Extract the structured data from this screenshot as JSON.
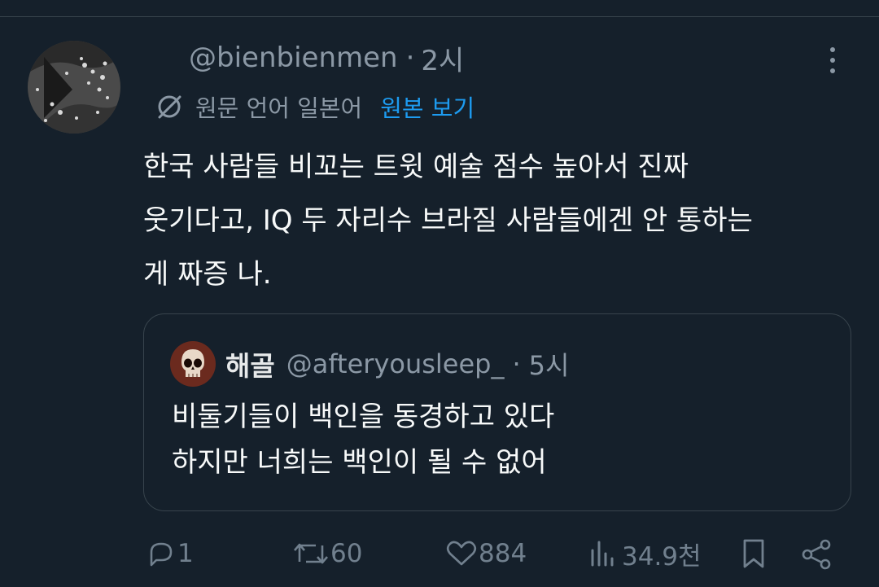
{
  "tweet": {
    "handle": "@bienbienmen",
    "separator": "·",
    "time": "2시",
    "translation": {
      "label": "원문 언어 일본어",
      "show_original": "원본 보기"
    },
    "lines": [
      "한국 사람들 비꼬는 트윗 예술 점수 높아서 진짜",
      "웃기다고, IQ 두 자리수 브라질 사람들에겐 안 통하는",
      "게 짜증 나."
    ]
  },
  "quote": {
    "name": "해골",
    "handle": "@afteryousleep_",
    "separator": "·",
    "time": "5시",
    "lines": [
      "비둘기들이 백인을 동경하고 있다",
      "하지만 너희는 백인이 될 수 없어"
    ]
  },
  "actions": {
    "reply_count": "1",
    "retweet_count": "60",
    "like_count": "884",
    "view_count": "34.9천"
  },
  "icons": {
    "reply": "reply-icon",
    "retweet": "retweet-icon",
    "like": "heart-icon",
    "views": "views-icon",
    "bookmark": "bookmark-icon",
    "share": "share-icon",
    "more": "more-options-icon",
    "translate": "translate-icon"
  },
  "colors": {
    "background": "#15202b",
    "accent": "#1d9bf0",
    "muted": "#8b98a5",
    "border": "#38444d"
  }
}
